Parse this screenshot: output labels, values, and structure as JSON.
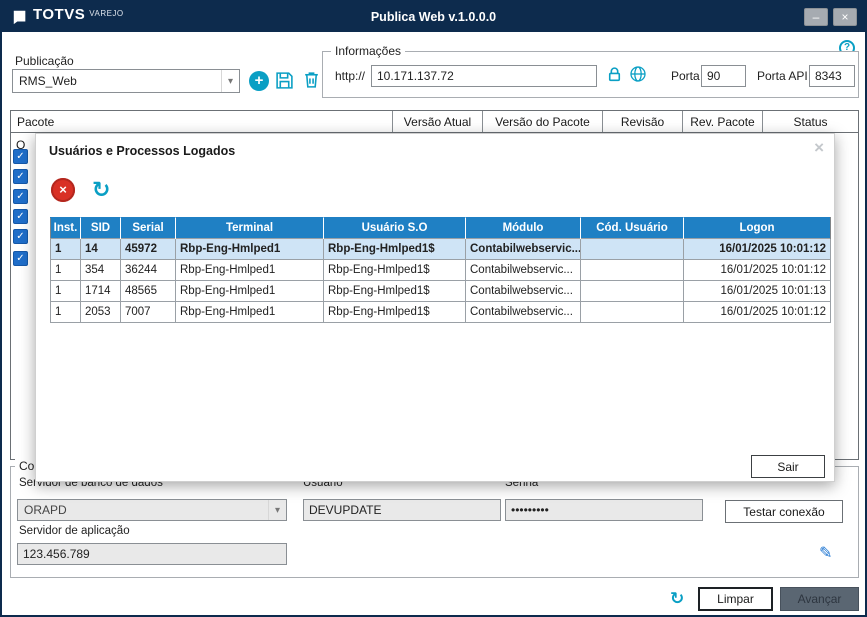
{
  "window": {
    "brand": "TOTVS",
    "brand_sub": "VAREJO",
    "title": "Publica Web v.1.0.0.0"
  },
  "icons": {
    "minimize": "–",
    "close": "×",
    "help": "?",
    "add": "+",
    "refresh": "↻",
    "edit": "✎",
    "dropdown": "▾",
    "check": "✓",
    "cancel": "×"
  },
  "colors": {
    "titlebar": "#0d2b4d",
    "accent_teal": "#0a9fc4",
    "grid_header_blue": "#1f80c4",
    "selected_row": "#cfe4f6",
    "danger_red": "#d93025",
    "checkbox_blue": "#1f6ec9",
    "edit_icon_blue": "#1a73d1"
  },
  "publicacao": {
    "label": "Publicação",
    "value": "RMS_Web"
  },
  "info": {
    "label": "Informações",
    "protocol": "http://",
    "host": "10.171.137.72",
    "porta_label": "Porta",
    "porta": "90",
    "porta_api_label": "Porta API",
    "porta_api": "8343"
  },
  "package_table": {
    "columns": [
      "Pacote",
      "Versão Atual",
      "Versão do Pacote",
      "Revisão",
      "Rev. Pacote",
      "Status"
    ],
    "partial_text": "O"
  },
  "modal": {
    "title": "Usuários e Processos Logados",
    "sair": "Sair",
    "table": {
      "columns": [
        "Inst.",
        "SID",
        "Serial",
        "Terminal",
        "Usuário S.O",
        "Módulo",
        "Cód. Usuário",
        "Logon"
      ],
      "rows": [
        {
          "inst": "1",
          "sid": "14",
          "serial": "45972",
          "terminal": "Rbp-Eng-Hmlped1",
          "usuario_so": "Rbp-Eng-Hmlped1$",
          "modulo": "Contabilwebservic...",
          "cod_usuario": "",
          "logon": "16/01/2025 10:01:12"
        },
        {
          "inst": "1",
          "sid": "354",
          "serial": "36244",
          "terminal": "Rbp-Eng-Hmlped1",
          "usuario_so": "Rbp-Eng-Hmlped1$",
          "modulo": "Contabilwebservic...",
          "cod_usuario": "",
          "logon": "16/01/2025 10:01:12"
        },
        {
          "inst": "1",
          "sid": "1714",
          "serial": "48565",
          "terminal": "Rbp-Eng-Hmlped1",
          "usuario_so": "Rbp-Eng-Hmlped1$",
          "modulo": "Contabilwebservic...",
          "cod_usuario": "",
          "logon": "16/01/2025 10:01:13"
        },
        {
          "inst": "1",
          "sid": "2053",
          "serial": "7007",
          "terminal": "Rbp-Eng-Hmlped1",
          "usuario_so": "Rbp-Eng-Hmlped1$",
          "modulo": "Contabilwebservic...",
          "cod_usuario": "",
          "logon": "16/01/2025 10:01:12"
        }
      ]
    }
  },
  "connection": {
    "group_label": "Co",
    "db_label": "Servidor de banco de dados",
    "db_value": "ORAPD",
    "user_label": "Usuário",
    "user_value": "DEVUPDATE",
    "senha_label": "Senha",
    "senha_value": "•••••••••",
    "testar": "Testar conexão",
    "app_label": "Servidor de aplicação",
    "app_value": "123.456.789"
  },
  "footer": {
    "limpar": "Limpar",
    "avancar": "Avançar"
  }
}
